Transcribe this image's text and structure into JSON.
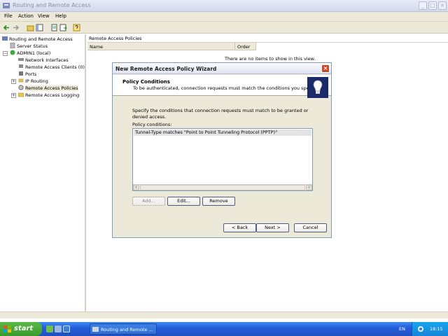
{
  "window": {
    "title": "Routing and Remote Access",
    "controls": [
      "_",
      "□",
      "×"
    ]
  },
  "menu": [
    "File",
    "Action",
    "View",
    "Help"
  ],
  "tree": {
    "root": "Routing and Remote Access",
    "items": [
      {
        "label": "Server Status"
      },
      {
        "label": "ADMIN1 (local)"
      },
      {
        "label": "Network Interfaces"
      },
      {
        "label": "Remote Access Clients (0)"
      },
      {
        "label": "Ports"
      },
      {
        "label": "IP Routing"
      },
      {
        "label": "Remote Access Policies"
      },
      {
        "label": "Remote Access Logging"
      }
    ]
  },
  "right_pane": {
    "header": "Remote Access Policies",
    "columns": [
      "Name",
      "Order"
    ],
    "empty_message": "There are no items to show in this view."
  },
  "dialog": {
    "title": "New Remote Access Policy Wizard",
    "heading": "Policy Conditions",
    "subheading": "To be authenticated, connection requests must match the conditions you specify.",
    "description": "Specify the conditions that connection requests must match to be granted or denied access.",
    "list_label": "Policy conditions:",
    "conditions": [
      "Tunnel-Type matches \"Point to Point Tunneling Protocol (PPTP)\""
    ],
    "buttons": {
      "add": "Add...",
      "edit": "Edit...",
      "remove": "Remove",
      "back": "< Back",
      "next": "Next >",
      "cancel": "Cancel"
    }
  },
  "taskbar": {
    "start": "start",
    "task": "Routing and Remote ...",
    "language": "EN",
    "clock": "18:15"
  }
}
